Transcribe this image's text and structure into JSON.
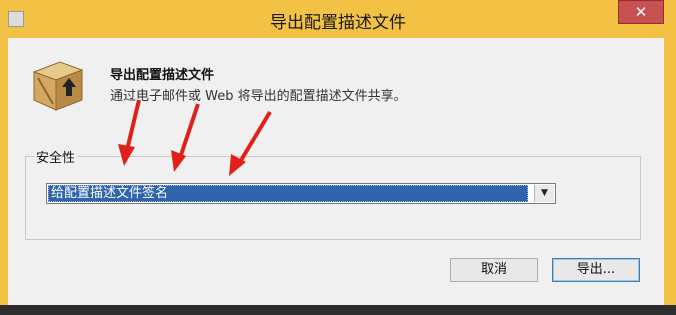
{
  "dialog": {
    "title": "导出配置描述文件",
    "close_glyph": "✕",
    "heading": "导出配置描述文件",
    "description": "通过电子邮件或 Web 将导出的配置描述文件共享。",
    "security_group_label": "安全性",
    "security_select": {
      "selected": "给配置描述文件签名"
    },
    "buttons": {
      "cancel": "取消",
      "export": "导出..."
    }
  },
  "icons": {
    "app": "window-icon",
    "package": "package-export-icon",
    "dropdown": "chevron-down-icon",
    "annotation": "red-arrow-icon"
  },
  "colors": {
    "title_bar": "#f3c244",
    "close_button": "#c75050",
    "selection": "#2f64ad",
    "annotation_arrow": "#e0201a"
  }
}
